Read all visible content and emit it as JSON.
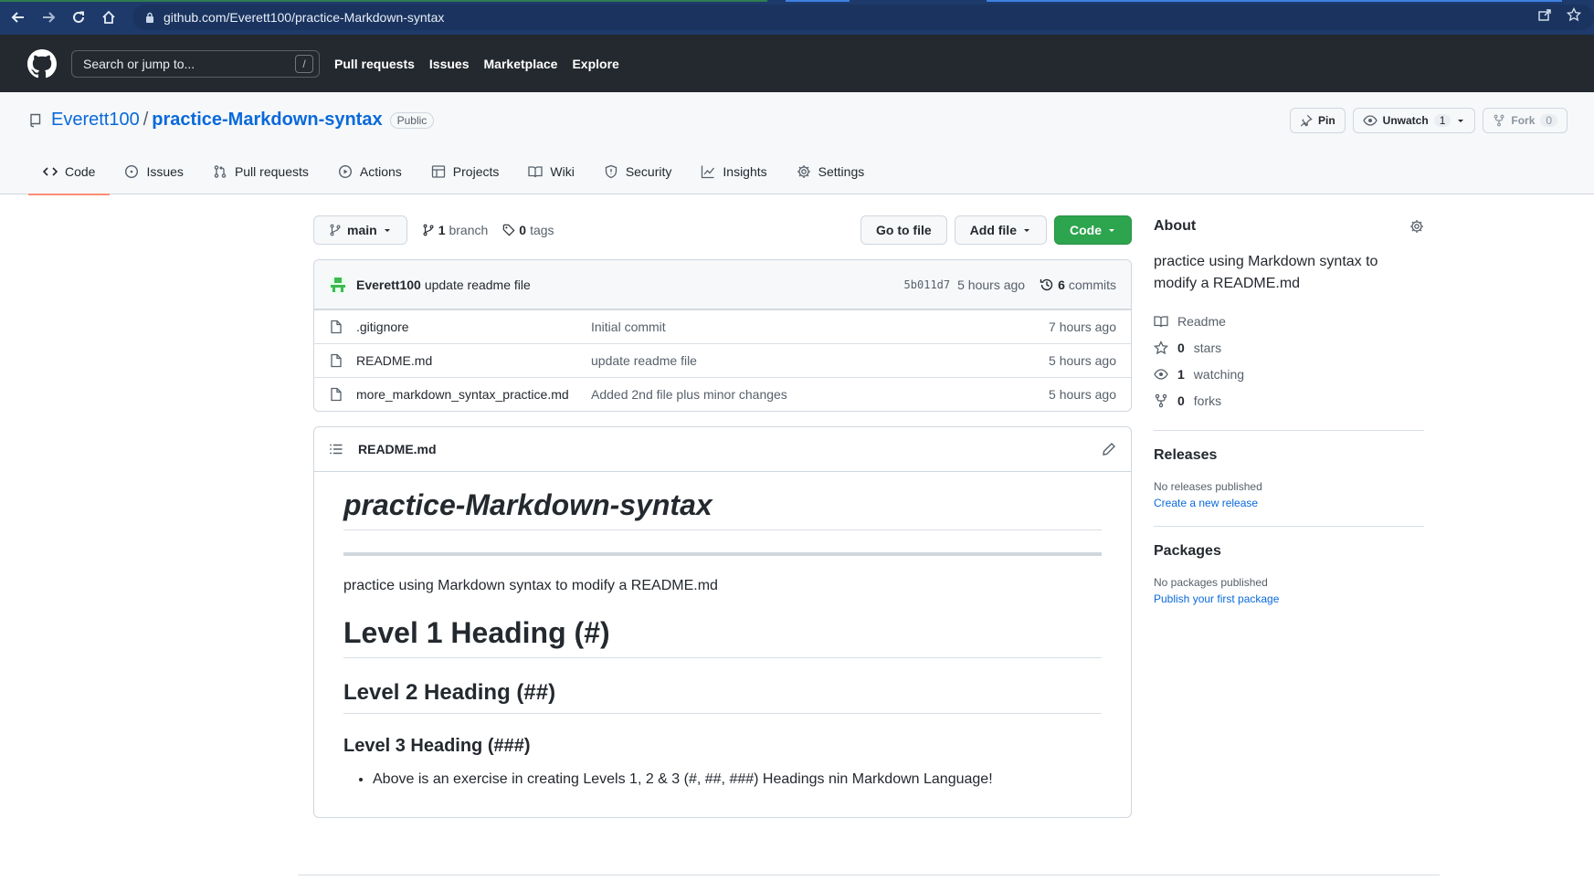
{
  "browser": {
    "url": "github.com/Everett100/practice-Markdown-syntax",
    "icons": [
      "back-arrow-icon",
      "forward-arrow-icon",
      "reload-icon",
      "home-icon",
      "lock-icon",
      "share-icon",
      "star-icon"
    ]
  },
  "header": {
    "search_placeholder": "Search or jump to...",
    "search_key": "/",
    "nav": [
      "Pull requests",
      "Issues",
      "Marketplace",
      "Explore"
    ]
  },
  "repo": {
    "owner": "Everett100",
    "separator": "/",
    "name": "practice-Markdown-syntax",
    "visibility": "Public",
    "actions": {
      "pin": "Pin",
      "unwatch": "Unwatch",
      "watch_count": "1",
      "fork": "Fork",
      "fork_count": "0"
    },
    "tabs": [
      "Code",
      "Issues",
      "Pull requests",
      "Actions",
      "Projects",
      "Wiki",
      "Security",
      "Insights",
      "Settings"
    ],
    "active_tab": "Code"
  },
  "file_nav": {
    "branch": "main",
    "branches_count": "1",
    "branches_label": "branch",
    "tags_count": "0",
    "tags_label": "tags",
    "go_to_file": "Go to file",
    "add_file": "Add file",
    "code": "Code"
  },
  "latest_commit": {
    "author": "Everett100",
    "message": "update readme file",
    "sha": "5b011d7",
    "time": "5 hours ago",
    "commits_count": "6",
    "commits_label": "commits"
  },
  "files": [
    {
      "name": ".gitignore",
      "message": "Initial commit",
      "age": "7 hours ago"
    },
    {
      "name": "README.md",
      "message": "update readme file",
      "age": "5 hours ago"
    },
    {
      "name": "more_markdown_syntax_practice.md",
      "message": "Added 2nd file plus minor changes",
      "age": "5 hours ago"
    }
  ],
  "readme": {
    "filename": "README.md",
    "title": "practice-Markdown-syntax",
    "intro": "practice using Markdown syntax to modify a README.md",
    "h1": "Level 1 Heading (#)",
    "h2": "Level 2 Heading (##)",
    "h3": "Level 3 Heading (###)",
    "bullet": "Above is an exercise in creating Levels 1, 2 & 3 (#, ##, ###) Headings nin Markdown Language!"
  },
  "about": {
    "heading": "About",
    "description": "practice using Markdown syntax to modify a README.md",
    "readme": "Readme",
    "stars_count": "0",
    "stars_label": "stars",
    "watching_count": "1",
    "watching_label": "watching",
    "forks_count": "0",
    "forks_label": "forks"
  },
  "releases": {
    "heading": "Releases",
    "empty": "No releases published",
    "link": "Create a new release"
  },
  "packages": {
    "heading": "Packages",
    "empty": "No packages published",
    "link": "Publish your first package"
  },
  "colors": {
    "browser_bar": "#1d3a6b",
    "header_bg": "#24292f",
    "link": "#0969da",
    "primary_button": "#2da44e",
    "active_tab_underline": "#fd8c73"
  }
}
